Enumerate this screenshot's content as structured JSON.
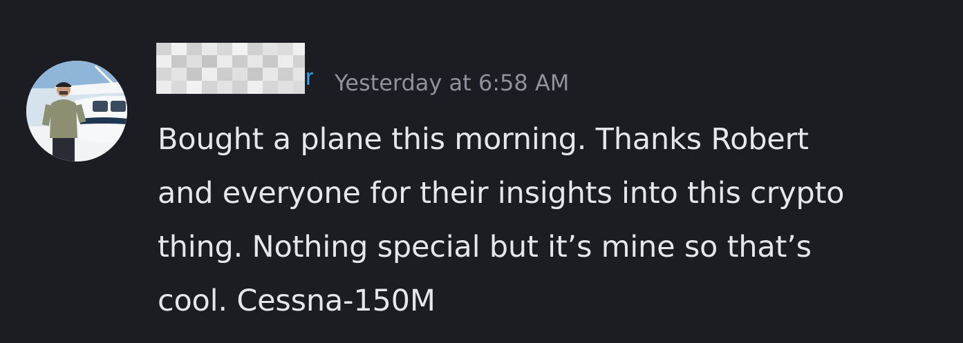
{
  "message": {
    "username_visible_fragment": "r",
    "timestamp": "Yesterday at 6:58 AM",
    "content_lines": [
      "Bought a plane this morning. Thanks Robert",
      "and everyone for their insights into this crypto",
      "thing. Nothing special but it’s mine so that’s",
      "cool. Cessna-150M"
    ]
  },
  "colors": {
    "background": "#1c1d22",
    "username": "#3aa0e6",
    "timestamp": "#8f929b",
    "text": "#e6e7ea"
  }
}
